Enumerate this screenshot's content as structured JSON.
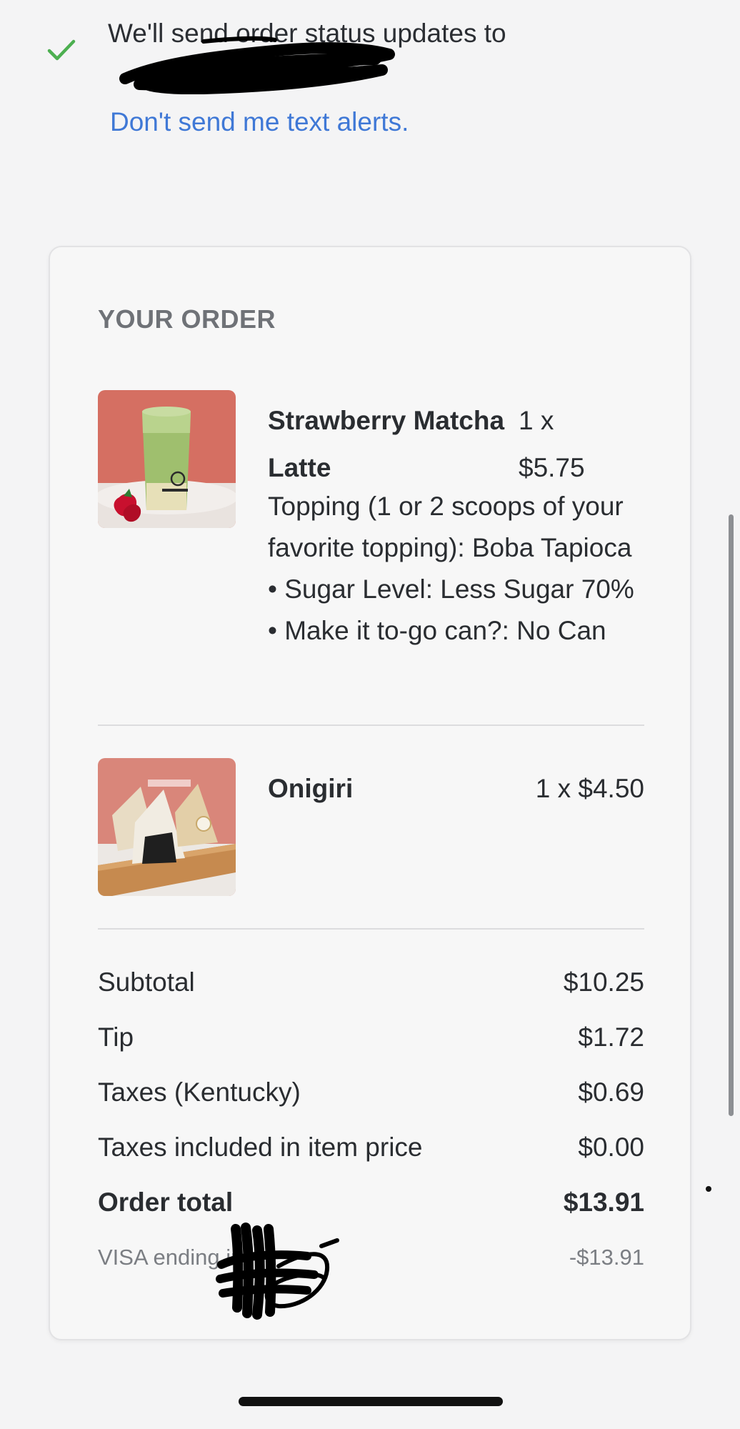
{
  "sms_notice": {
    "message": "We'll send order status updates to",
    "opt_out_link": "Don't send me text alerts.",
    "check_color": "#4caf50",
    "link_color": "#3f78d6"
  },
  "order": {
    "heading": "YOUR ORDER",
    "items": [
      {
        "name": "Strawberry Matcha Latte",
        "price": "1 x $5.75",
        "modifiers": "Topping (1 or 2 scoops of your favorite topping): Boba Tapioca • Sugar Level: Less Sugar 70% • Make it to-go can?: No Can",
        "image": "matcha-latte-photo"
      },
      {
        "name": "Onigiri",
        "price": "1 x $4.50",
        "modifiers": "",
        "image": "onigiri-photo"
      }
    ],
    "totals": [
      {
        "label": "Subtotal",
        "value": "$10.25"
      },
      {
        "label": "Tip",
        "value": "$1.72"
      },
      {
        "label": "Taxes (Kentucky)",
        "value": "$0.69"
      },
      {
        "label": "Taxes included in item price",
        "value": "$0.00"
      }
    ],
    "order_total": {
      "label": "Order total",
      "value": "$13.91"
    },
    "payment": {
      "label": "VISA ending in",
      "value": "-$13.91"
    }
  }
}
